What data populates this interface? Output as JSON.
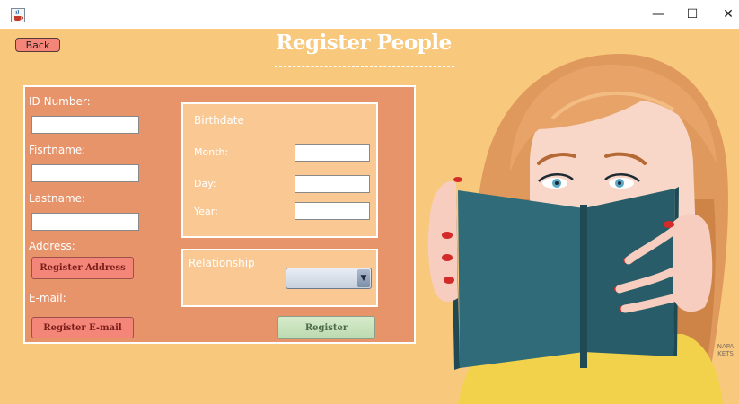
{
  "window": {
    "app_icon": "java-coffee-icon",
    "minimize": "—",
    "maximize": "☐",
    "close": "✕"
  },
  "back_label": "Back",
  "title": "Register People",
  "form": {
    "id_label": "ID Number:",
    "id_value": "",
    "firstname_label": "Fisrtname:",
    "firstname_value": "",
    "lastname_label": "Lastname:",
    "lastname_value": "",
    "address_label": "Address:",
    "register_address_label": "Register Address",
    "email_label": "E-mail:",
    "register_email_label": "Register E-mail",
    "birthdate": {
      "title": "Birthdate",
      "month_label": "Month:",
      "month_value": "",
      "day_label": "Day:",
      "day_value": "",
      "year_label": "Year:",
      "year_value": ""
    },
    "relationship": {
      "title": "Relationship",
      "selected": "",
      "arrow_icon": "chevron-down-icon"
    },
    "register_label": "Register"
  },
  "colors": {
    "background": "#f8c97d",
    "form_panel": "#e8946b",
    "sub_panel": "#fac893",
    "button_red": "#f48579",
    "register_green": "#c6e0ba",
    "book": "#2a5f6d",
    "hair": "#e0995c"
  },
  "illustration_name": "woman-reading-book-illustration"
}
